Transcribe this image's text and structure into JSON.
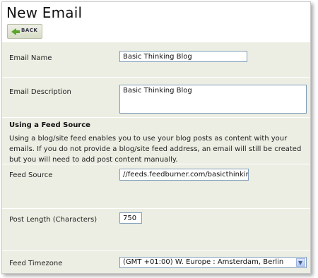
{
  "page": {
    "title": "New Email"
  },
  "toolbar": {
    "back_label": "BACK"
  },
  "form": {
    "email_name": {
      "label": "Email Name",
      "value": "Basic Thinking Blog"
    },
    "email_description": {
      "label": "Email Description",
      "value": "Basic Thinking Blog"
    },
    "feed_section": {
      "title": "Using a Feed Source",
      "text": "Using a blog/site feed enables you to use your blog posts as content with your emails. If you do not provide a blog/site feed address, an email will still be created but you will need to add post content manually."
    },
    "feed_source": {
      "label": "Feed Source",
      "value": "//feeds.feedburner.com/basicthinking/rss"
    },
    "post_length": {
      "label": "Post Length (Characters)",
      "value": "750"
    },
    "feed_timezone": {
      "label": "Feed Timezone",
      "selected": "(GMT +01:00) W. Europe : Amsterdam, Berlin"
    }
  },
  "colors": {
    "panel_bg": "#eceee3",
    "back_arrow": "#5aa52a",
    "input_border": "#7f9db9"
  },
  "icons": {
    "back": "green-left-arrow-icon",
    "select": "chevron-down-icon"
  }
}
